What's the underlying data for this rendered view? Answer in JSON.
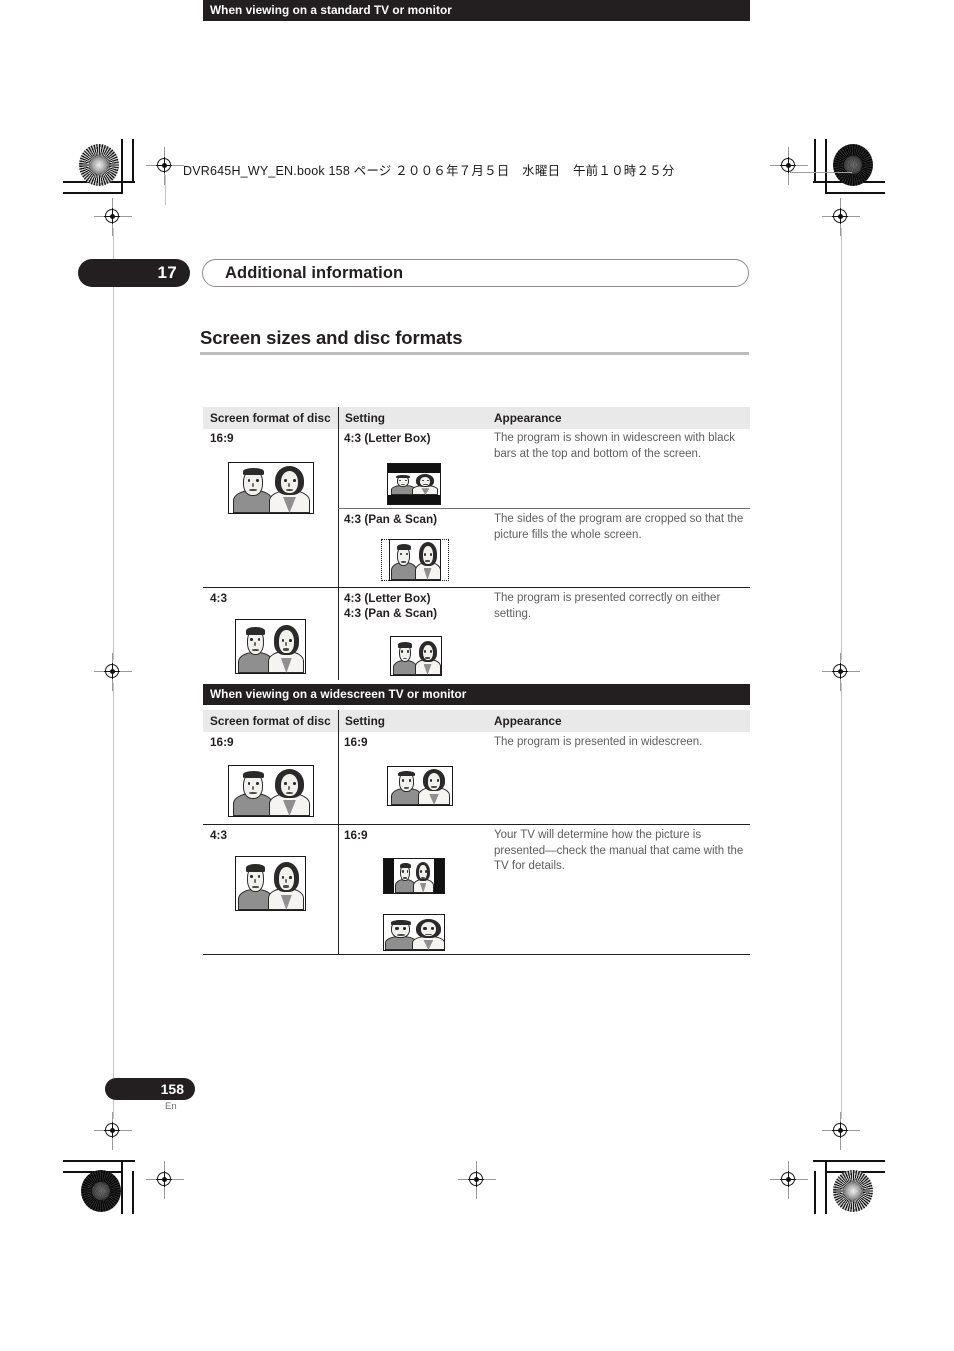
{
  "file_info": "DVR645H_WY_EN.book  158 ページ  ２００６年７月５日　水曜日　午前１０時２５分",
  "chapter": {
    "number": "17",
    "title": "Additional information"
  },
  "section_heading": "Screen sizes and disc formats",
  "tables": [
    {
      "band": "When viewing on a standard TV or monitor",
      "columns": [
        "Screen format of disc",
        "Setting",
        "Appearance"
      ],
      "rows": [
        {
          "disc_format": "16:9",
          "disc_thumb": "widescreen-16-9",
          "settings": [
            {
              "label": "4:3 (Letter Box)",
              "thumb": "letterbox-4-3",
              "description": "The program is shown in widescreen with black bars at the top and bottom of the screen."
            },
            {
              "label": "4:3 (Pan & Scan)",
              "thumb": "panscan-4-3",
              "description": "The sides of the program are cropped so that the picture fills the whole screen."
            }
          ]
        },
        {
          "disc_format": "4:3",
          "disc_thumb": "standard-4-3",
          "settings": [
            {
              "label": "4:3 (Letter Box)\n4:3 (Pan & Scan)",
              "thumb": "standard-4-3-small",
              "description": "The program is presented correctly on either setting."
            }
          ]
        }
      ]
    },
    {
      "band": "When viewing on a widescreen TV or monitor",
      "columns": [
        "Screen format of disc",
        "Setting",
        "Appearance"
      ],
      "rows": [
        {
          "disc_format": "16:9",
          "disc_thumb": "widescreen-16-9",
          "settings": [
            {
              "label": "16:9",
              "thumb": "widescreen-16-9-small",
              "description": "The program is presented in widescreen."
            }
          ]
        },
        {
          "disc_format": "4:3",
          "disc_thumb": "standard-4-3",
          "settings": [
            {
              "label": "16:9",
              "thumb": "pillarbox-16-9",
              "thumb2": "stretched-16-9",
              "description": "Your TV will determine how the picture is presented—check the manual that came with the TV for details."
            }
          ]
        }
      ]
    }
  ],
  "footer": {
    "page_number": "158",
    "language": "En"
  },
  "colors": {
    "band_bg": "#231f20",
    "colhead_bg": "#e9e9e9",
    "body_text": "#231f20",
    "desc_text": "#5d5d5d",
    "rule": "#bdbdbd"
  }
}
